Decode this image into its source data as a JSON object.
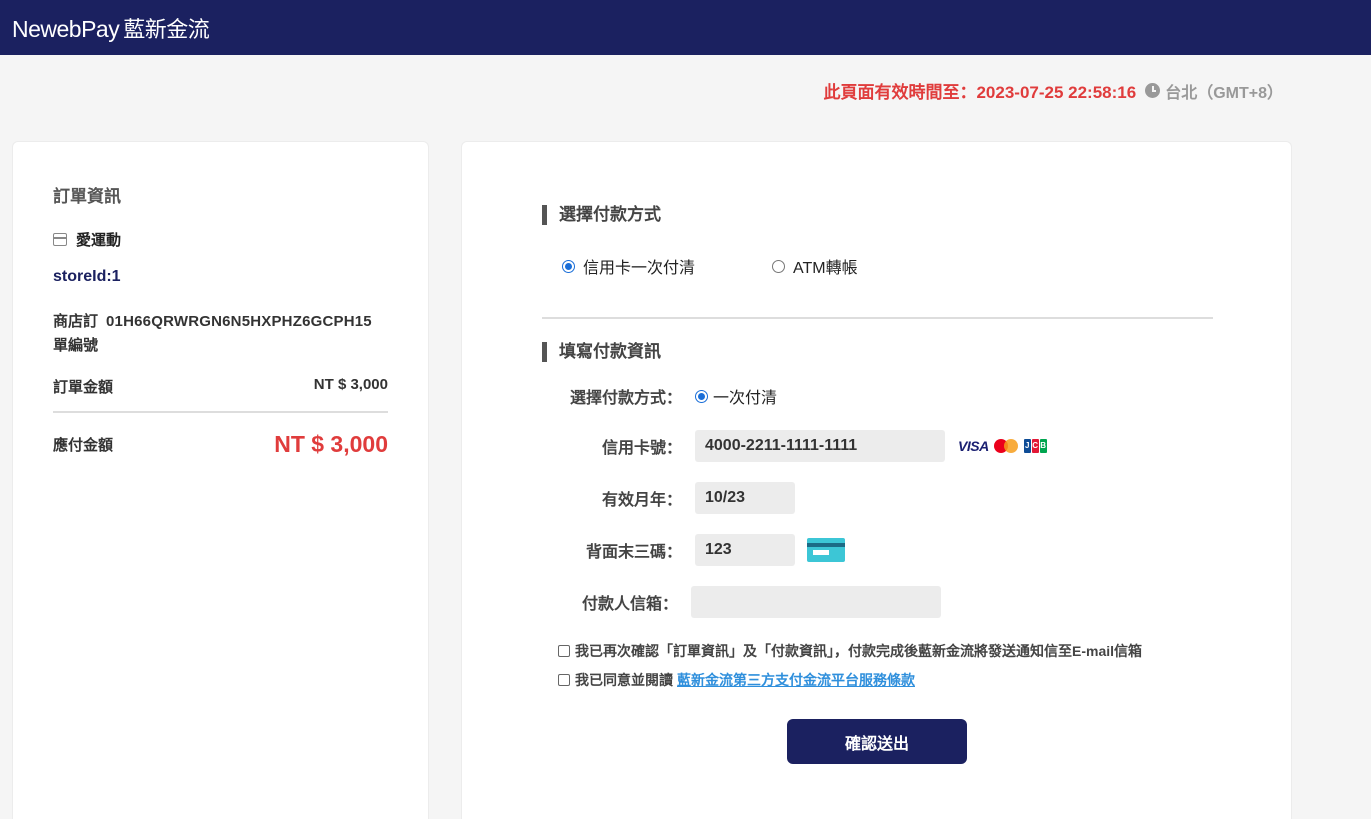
{
  "header": {
    "brand_en": "NewebPay",
    "brand_cn": "藍新金流"
  },
  "expiry": {
    "label": "此頁面有效時間至：2023-07-25 22:58:16",
    "clock_icon": "clock-icon",
    "timezone": "台北（GMT+8）"
  },
  "order": {
    "title": "訂單資訊",
    "store_name": "愛運動",
    "store_id": "storeId:1",
    "order_no_label": "商店訂單編號",
    "order_no": "01H66QRWRGN6N5HXPHZ6GCPH15",
    "amount_label": "訂單金額",
    "amount_value": "NT $ 3,000",
    "due_label": "應付金額",
    "due_value": "NT $ 3,000"
  },
  "payment": {
    "method_title": "選擇付款方式",
    "methods": [
      {
        "label": "信用卡一次付清",
        "selected": true
      },
      {
        "label": "ATM轉帳",
        "selected": false
      }
    ],
    "info_title": "填寫付款資訊",
    "form": {
      "type_label": "選擇付款方式：",
      "type_value": "一次付清",
      "card_label": "信用卡號：",
      "card_value": "4000-2211-1111-1111",
      "card_brands": [
        "VISA",
        "MasterCard",
        "JCB"
      ],
      "expiry_label": "有效月年：",
      "expiry_value": "10/23",
      "cvv_label": "背面末三碼：",
      "cvv_value": "123",
      "email_label": "付款人信箱：",
      "email_value": ""
    },
    "confirm_text": "我已再次確認「訂單資訊」及「付款資訊」，付款完成後藍新金流將發送通知信至E-mail信箱",
    "agree_text": "我已同意並閱讀",
    "agree_link": "藍新金流第三方支付金流平台服務條款",
    "submit_label": "確認送出"
  }
}
